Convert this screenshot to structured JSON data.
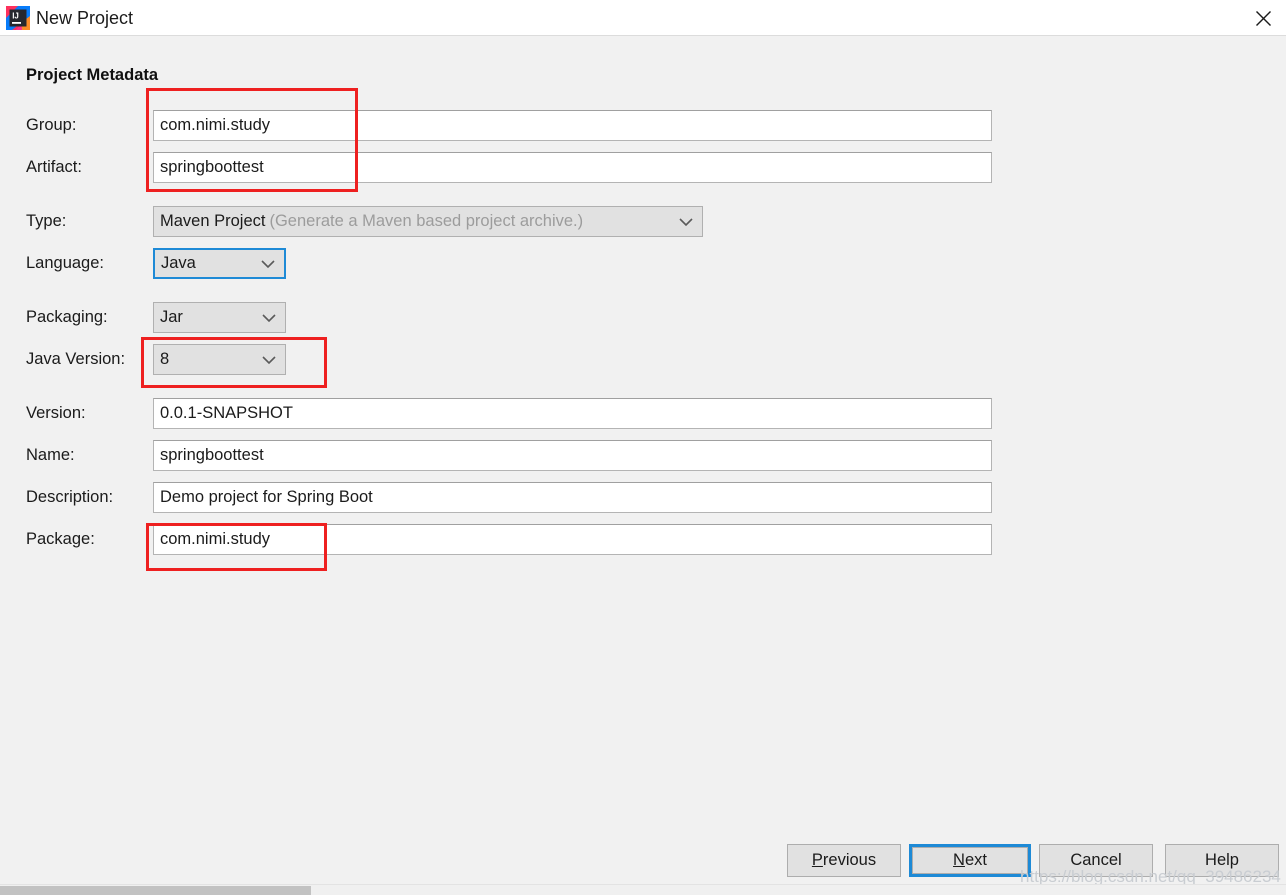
{
  "window": {
    "title": "New Project",
    "app_icon": "intellij-idea-icon",
    "close_icon": "close-icon"
  },
  "form": {
    "section_title": "Project Metadata",
    "fields": [
      {
        "label": "Group:",
        "value": "com.nimi.study",
        "kind": "text"
      },
      {
        "label": "Artifact:",
        "value": "springboottest",
        "kind": "text"
      },
      {
        "label": "Type:",
        "value": "Maven Project",
        "hint": "(Generate a Maven based project archive.)",
        "kind": "combo"
      },
      {
        "label": "Language:",
        "value": "Java",
        "kind": "combo"
      },
      {
        "label": "Packaging:",
        "value": "Jar",
        "kind": "combo"
      },
      {
        "label": "Java Version:",
        "value": "8",
        "kind": "combo"
      },
      {
        "label": "Version:",
        "value": "0.0.1-SNAPSHOT",
        "kind": "text"
      },
      {
        "label": "Name:",
        "value": "springboottest",
        "kind": "text"
      },
      {
        "label": "Description:",
        "value": "Demo project for Spring Boot",
        "kind": "text"
      },
      {
        "label": "Package:",
        "value": "com.nimi.study",
        "kind": "text"
      }
    ]
  },
  "footer": {
    "previous": {
      "pre": "",
      "mnemonic": "P",
      "post": "revious"
    },
    "next": {
      "pre": "",
      "mnemonic": "N",
      "post": "ext"
    },
    "cancel": {
      "label": "Cancel"
    },
    "help": {
      "label": "Help"
    }
  },
  "watermark": {
    "text": "https://blog.csdn.net/qq_39486234"
  },
  "colors": {
    "accent_focus": "#1e8ad6",
    "annotation": "#ee2020",
    "dialog_bg": "#f1f1f1",
    "field_bg": "#ffffff",
    "combo_bg": "#e1e1e1"
  }
}
